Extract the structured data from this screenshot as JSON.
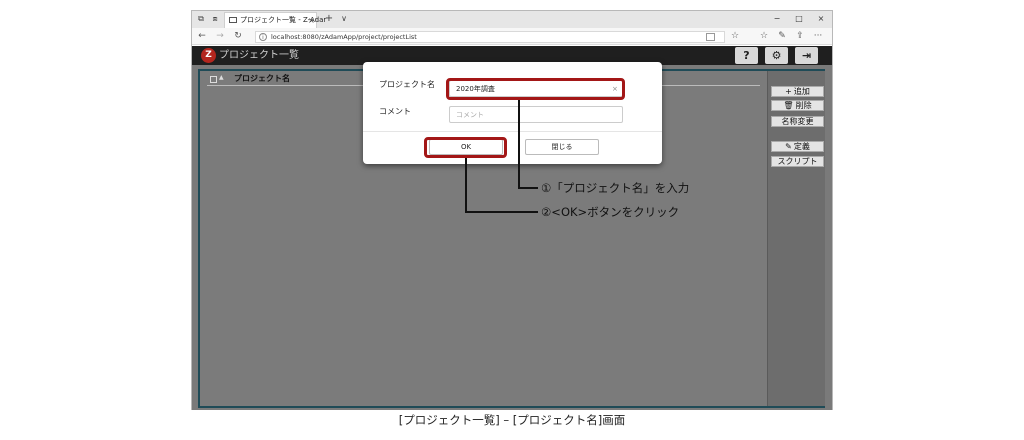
{
  "browser": {
    "tab_title": "プロジェクト一覧 - Z-Adar",
    "tab_close": "×",
    "new_tab": "+",
    "tab_menu": "∨",
    "url": "localhost:8080/zAdamApp/project/projectList",
    "window_controls": [
      "−",
      "□",
      "×"
    ],
    "nav_back": "←",
    "nav_forward": "→",
    "nav_refresh": "↻",
    "more": "···"
  },
  "app": {
    "logo_text": "Z",
    "title": "プロジェクト一覧",
    "header_buttons": [
      "?",
      "⚙",
      "⇥"
    ]
  },
  "list": {
    "sort_mark": "▲",
    "column_header": "プロジェクト名"
  },
  "sidebar": {
    "buttons": [
      {
        "icon": "+",
        "label": "追加"
      },
      {
        "icon": "🗑",
        "label": "削除"
      },
      {
        "icon": "",
        "label": "名称変更"
      },
      {
        "icon": "✎",
        "label": "定義"
      },
      {
        "icon": "",
        "label": "スクリプト"
      }
    ]
  },
  "modal": {
    "name_label": "プロジェクト名",
    "name_value": "2020年調査",
    "clear_icon": "×",
    "comment_label": "コメント",
    "comment_placeholder": "コメント",
    "ok_label": "OK",
    "close_label": "閉じる"
  },
  "annotations": {
    "step1": "①「プロジェクト名」を入力",
    "step2": "②<OK>ボタンをクリック",
    "highlight_color": "#a31717"
  },
  "caption": "[プロジェクト一覧] – [プロジェクト名]画面"
}
